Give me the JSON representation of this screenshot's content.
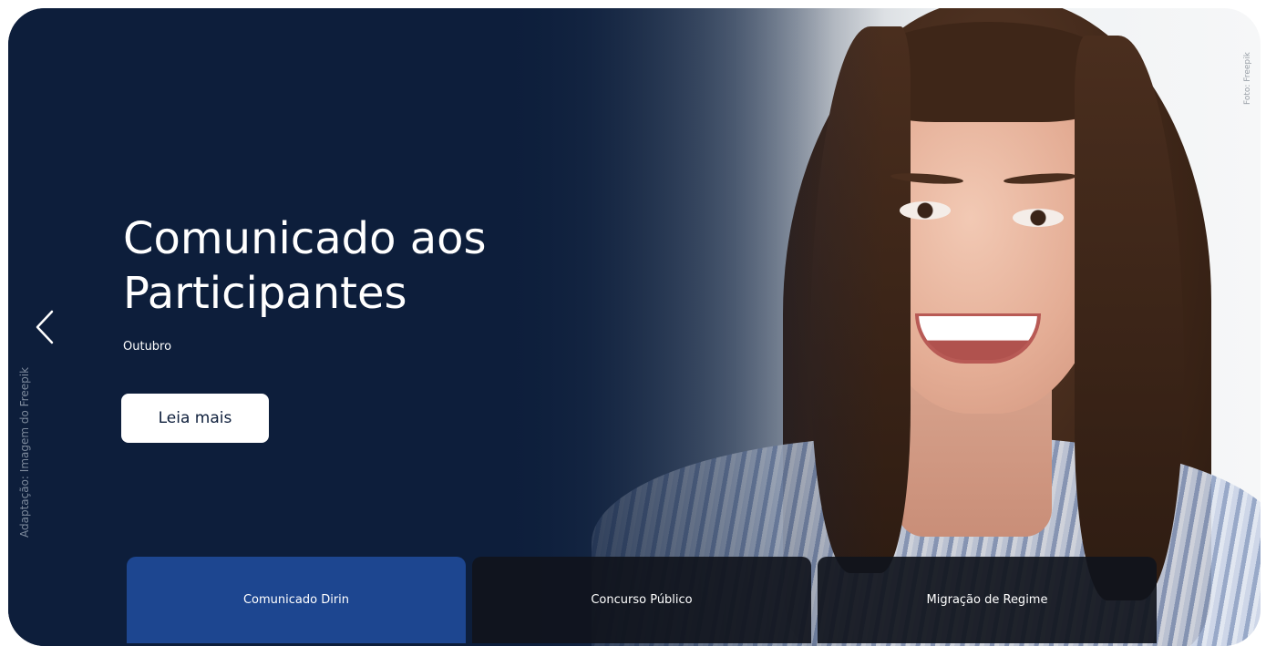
{
  "hero": {
    "title": "Comunicado aos Participantes",
    "subtitle": "Outubro",
    "cta_label": "Leia mais",
    "prev_icon": "chevron-left-icon",
    "image_credit_side": "Adaptação: Imagem do Freepik",
    "image_credit_top": "Foto: Freepik"
  },
  "tabs": [
    {
      "label": "Comunicado Dirin",
      "active": true
    },
    {
      "label": "Concurso Público",
      "active": false
    },
    {
      "label": "Migração de Regime",
      "active": false
    }
  ],
  "colors": {
    "navy": "#0d1e3b",
    "active_tab": "#1d4690",
    "dark_tab": "#10141c",
    "white": "#ffffff"
  }
}
